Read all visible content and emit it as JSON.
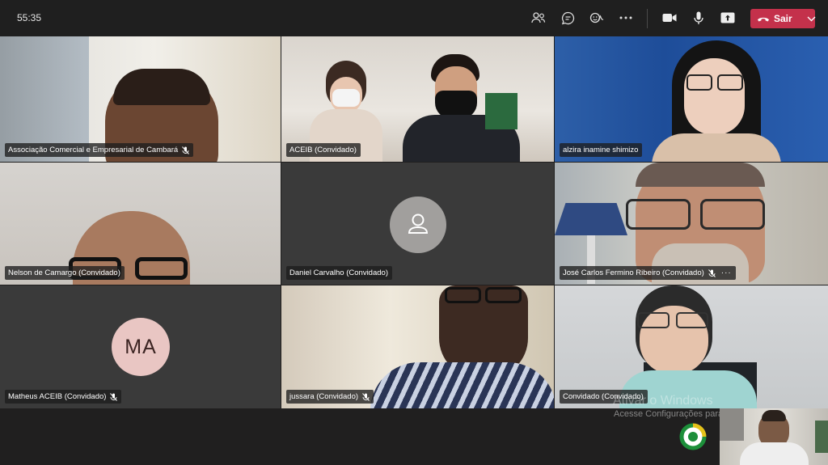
{
  "call": {
    "timer": "55:35",
    "leave_label": "Sair"
  },
  "toolbar": {
    "icons": [
      "people-icon",
      "chat-icon",
      "reactions-icon",
      "more-actions-icon",
      "camera-icon",
      "microphone-icon",
      "share-screen-icon",
      "hang-up-icon",
      "chevron-down-icon"
    ]
  },
  "participants": [
    {
      "name": "Associação Comercial e Empresarial de Cambará",
      "muted": true
    },
    {
      "name": "ACEIB (Convidado)",
      "muted": false
    },
    {
      "name": "alzira inamine shimizo",
      "muted": false
    },
    {
      "name": "Nelson de Camargo (Convidado)",
      "muted": false
    },
    {
      "name": "Daniel Carvalho (Convidado)",
      "muted": false
    },
    {
      "name": "José Carlos Fermino Ribeiro (Convidado)",
      "muted": true,
      "more": "···"
    },
    {
      "name": "Matheus ACEIB (Convidado)",
      "muted": true,
      "initials": "MA"
    },
    {
      "name": "jussara (Convidado)",
      "muted": true
    },
    {
      "name": "Convidado (Convidado)",
      "muted": false
    }
  ],
  "overlay": {
    "watermark_title": "Ativar o Windows",
    "watermark_sub": "Acesse Configurações para ativar o Windows."
  },
  "colors": {
    "leave_button": "#c4314b",
    "topbar": "#1f1f1f",
    "background": "#201f1f",
    "initials_avatar": "#e9c6c3"
  }
}
